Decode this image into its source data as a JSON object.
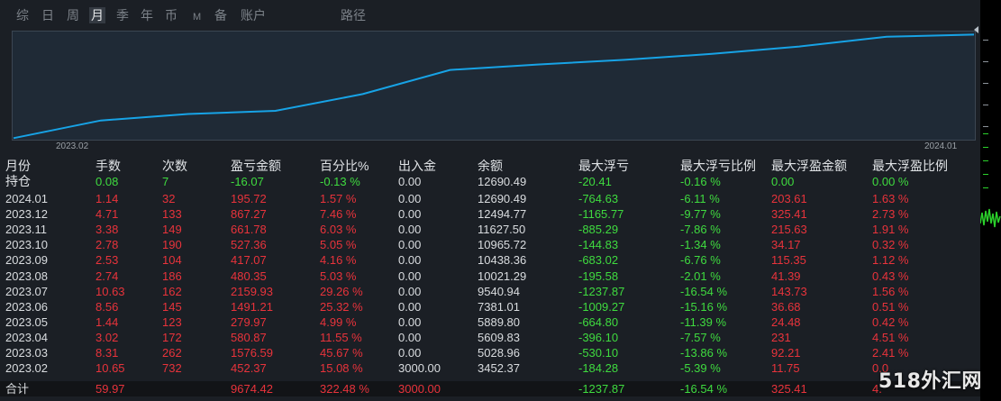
{
  "tabs": [
    {
      "label": "综",
      "active": false
    },
    {
      "label": "日",
      "active": false
    },
    {
      "label": "周",
      "active": false
    },
    {
      "label": "月",
      "active": true
    },
    {
      "label": "季",
      "active": false
    },
    {
      "label": "年",
      "active": false
    },
    {
      "label": "币",
      "active": false
    },
    {
      "label": "M",
      "active": false
    },
    {
      "label": "备",
      "active": false
    },
    {
      "label": "账户",
      "active": false
    },
    {
      "label": "路径",
      "active": false
    }
  ],
  "chart_data": {
    "type": "line",
    "x": [
      "2023.02",
      "2023.03",
      "2023.04",
      "2023.05",
      "2023.06",
      "2023.07",
      "2023.08",
      "2023.09",
      "2023.10",
      "2023.11",
      "2023.12",
      "2024.01"
    ],
    "values": [
      3452.37,
      5028.96,
      5609.83,
      5889.8,
      7381.01,
      9540.94,
      10021.29,
      10438.36,
      10965.72,
      11627.5,
      12494.77,
      12690.49
    ],
    "x_start_label": "2023.02",
    "x_end_label": "2024.01",
    "ylim": [
      3400,
      12800
    ],
    "grid": false,
    "line_color": "#17a3e6"
  },
  "headers": {
    "month": "月份",
    "lots": "手数",
    "count": "次数",
    "pnl": "盈亏金额",
    "pct": "百分比%",
    "io": "出入金",
    "balance": "余额",
    "maxfl": "最大浮亏",
    "maxfl_pct": "最大浮亏比例",
    "maxfp": "最大浮盈金额",
    "maxfp_pct": "最大浮盈比例"
  },
  "position_row": {
    "month": "持仓",
    "lots": "0.08",
    "count": "7",
    "pnl": "-16.07",
    "pct": "-0.13 %",
    "io": "0.00",
    "balance": "12690.49",
    "maxfl": "-20.41",
    "maxfl_pct": "-0.16 %",
    "maxfp": "0.00",
    "maxfp_pct": "0.00 %"
  },
  "rows": [
    {
      "month": "2024.01",
      "lots": "1.14",
      "count": "32",
      "pnl": "195.72",
      "pct": "1.57 %",
      "io": "0.00",
      "balance": "12690.49",
      "maxfl": "-764.63",
      "maxfl_pct": "-6.11 %",
      "maxfp": "203.61",
      "maxfp_pct": "1.63 %"
    },
    {
      "month": "2023.12",
      "lots": "4.71",
      "count": "133",
      "pnl": "867.27",
      "pct": "7.46 %",
      "io": "0.00",
      "balance": "12494.77",
      "maxfl": "-1165.77",
      "maxfl_pct": "-9.77 %",
      "maxfp": "325.41",
      "maxfp_pct": "2.73 %"
    },
    {
      "month": "2023.11",
      "lots": "3.38",
      "count": "149",
      "pnl": "661.78",
      "pct": "6.03 %",
      "io": "0.00",
      "balance": "11627.50",
      "maxfl": "-885.29",
      "maxfl_pct": "-7.86 %",
      "maxfp": "215.63",
      "maxfp_pct": "1.91 %"
    },
    {
      "month": "2023.10",
      "lots": "2.78",
      "count": "190",
      "pnl": "527.36",
      "pct": "5.05 %",
      "io": "0.00",
      "balance": "10965.72",
      "maxfl": "-144.83",
      "maxfl_pct": "-1.34 %",
      "maxfp": "34.17",
      "maxfp_pct": "0.32 %"
    },
    {
      "month": "2023.09",
      "lots": "2.53",
      "count": "104",
      "pnl": "417.07",
      "pct": "4.16 %",
      "io": "0.00",
      "balance": "10438.36",
      "maxfl": "-683.02",
      "maxfl_pct": "-6.76 %",
      "maxfp": "115.35",
      "maxfp_pct": "1.12 %"
    },
    {
      "month": "2023.08",
      "lots": "2.74",
      "count": "186",
      "pnl": "480.35",
      "pct": "5.03 %",
      "io": "0.00",
      "balance": "10021.29",
      "maxfl": "-195.58",
      "maxfl_pct": "-2.01 %",
      "maxfp": "41.39",
      "maxfp_pct": "0.43 %"
    },
    {
      "month": "2023.07",
      "lots": "10.63",
      "count": "162",
      "pnl": "2159.93",
      "pct": "29.26 %",
      "io": "0.00",
      "balance": "9540.94",
      "maxfl": "-1237.87",
      "maxfl_pct": "-16.54 %",
      "maxfp": "143.73",
      "maxfp_pct": "1.56 %"
    },
    {
      "month": "2023.06",
      "lots": "8.56",
      "count": "145",
      "pnl": "1491.21",
      "pct": "25.32 %",
      "io": "0.00",
      "balance": "7381.01",
      "maxfl": "-1009.27",
      "maxfl_pct": "-15.16 %",
      "maxfp": "36.68",
      "maxfp_pct": "0.51 %"
    },
    {
      "month": "2023.05",
      "lots": "1.44",
      "count": "123",
      "pnl": "279.97",
      "pct": "4.99 %",
      "io": "0.00",
      "balance": "5889.80",
      "maxfl": "-664.80",
      "maxfl_pct": "-11.39 %",
      "maxfp": "24.48",
      "maxfp_pct": "0.42 %"
    },
    {
      "month": "2023.04",
      "lots": "3.02",
      "count": "172",
      "pnl": "580.87",
      "pct": "11.55 %",
      "io": "0.00",
      "balance": "5609.83",
      "maxfl": "-396.10",
      "maxfl_pct": "-7.57 %",
      "maxfp": "231",
      "maxfp_pct": "4.51 %"
    },
    {
      "month": "2023.03",
      "lots": "8.31",
      "count": "262",
      "pnl": "1576.59",
      "pct": "45.67 %",
      "io": "0.00",
      "balance": "5028.96",
      "maxfl": "-530.10",
      "maxfl_pct": "-13.86 %",
      "maxfp": "92.21",
      "maxfp_pct": "2.41 %"
    },
    {
      "month": "2023.02",
      "lots": "10.65",
      "count": "732",
      "pnl": "452.37",
      "pct": "15.08 %",
      "io": "3000.00",
      "balance": "3452.37",
      "maxfl": "-184.28",
      "maxfl_pct": "-5.39 %",
      "maxfp": "11.75",
      "maxfp_pct": "0.0"
    }
  ],
  "total_row": {
    "month": "合计",
    "lots": "59.97",
    "count": "",
    "pnl": "9674.42",
    "pct": "322.48 %",
    "io": "3000.00",
    "balance": "",
    "maxfl": "-1237.87",
    "maxfl_pct": "-16.54 %",
    "maxfp": "325.41",
    "maxfp_pct": "4."
  },
  "watermark": "518外汇网",
  "colors": {
    "positive": "#e8333b",
    "negative": "#3fdb3f",
    "neutral": "#d9dcdf",
    "line": "#17a3e6"
  }
}
